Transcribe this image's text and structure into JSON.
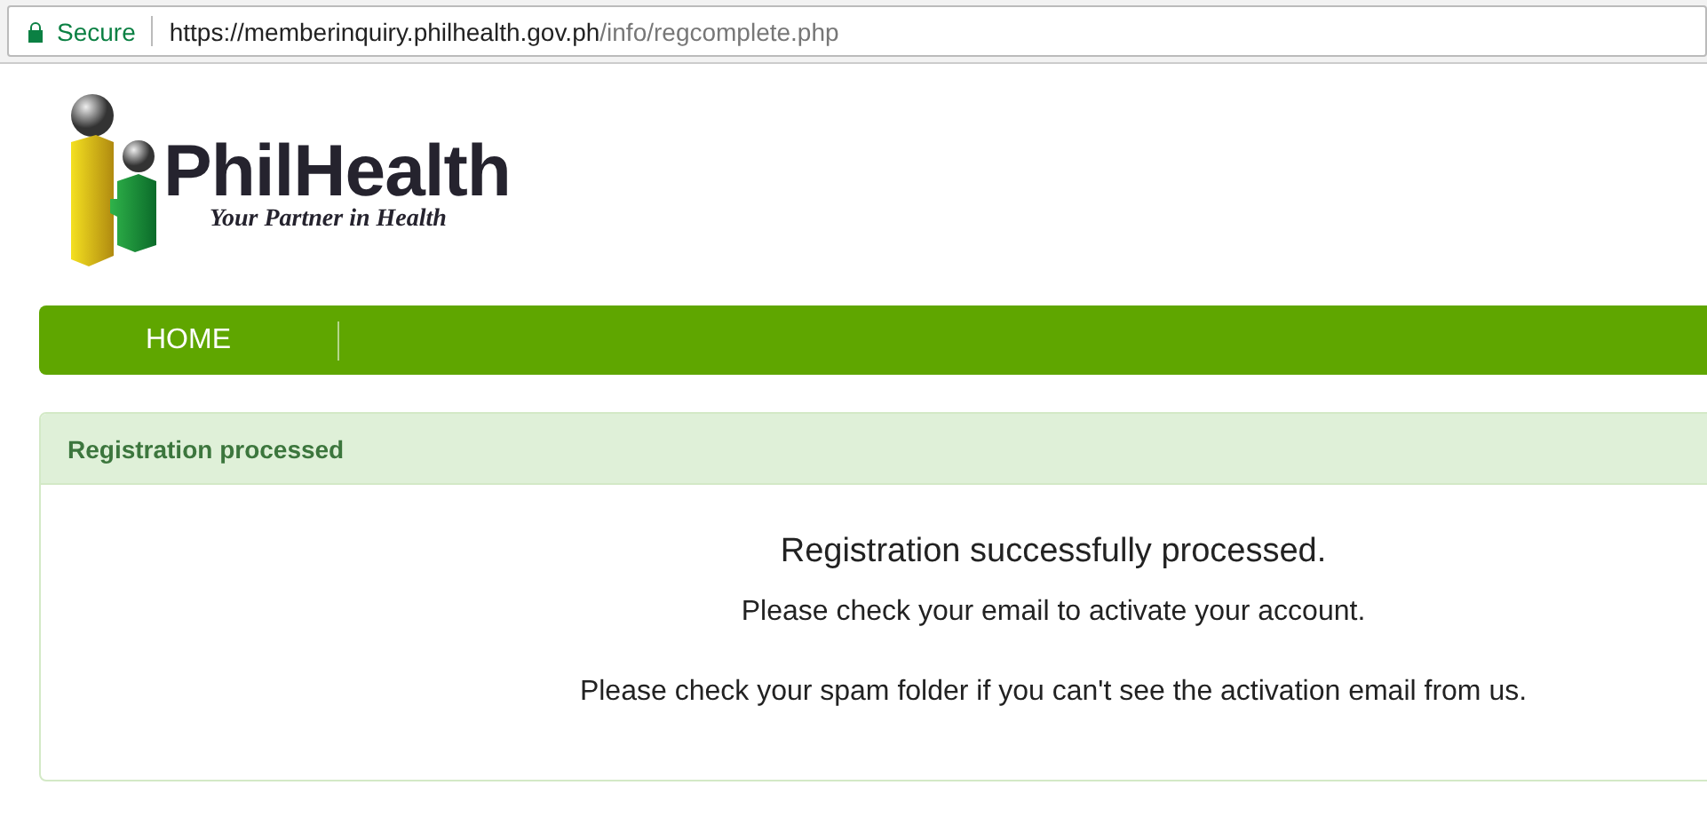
{
  "address_bar": {
    "security_label": "Secure",
    "url_host": "https://memberinquiry.philhealth.gov.ph",
    "url_path": "/info/regcomplete.php"
  },
  "logo": {
    "name": "PhilHealth",
    "tagline": "Your Partner in Health"
  },
  "nav": [
    {
      "label": "HOME"
    }
  ],
  "panel": {
    "heading": "Registration processed",
    "title": "Registration successfully processed.",
    "lines": [
      "Please check your email to activate your account.",
      "Please check your spam folder if you can't see the activation email from us."
    ]
  }
}
